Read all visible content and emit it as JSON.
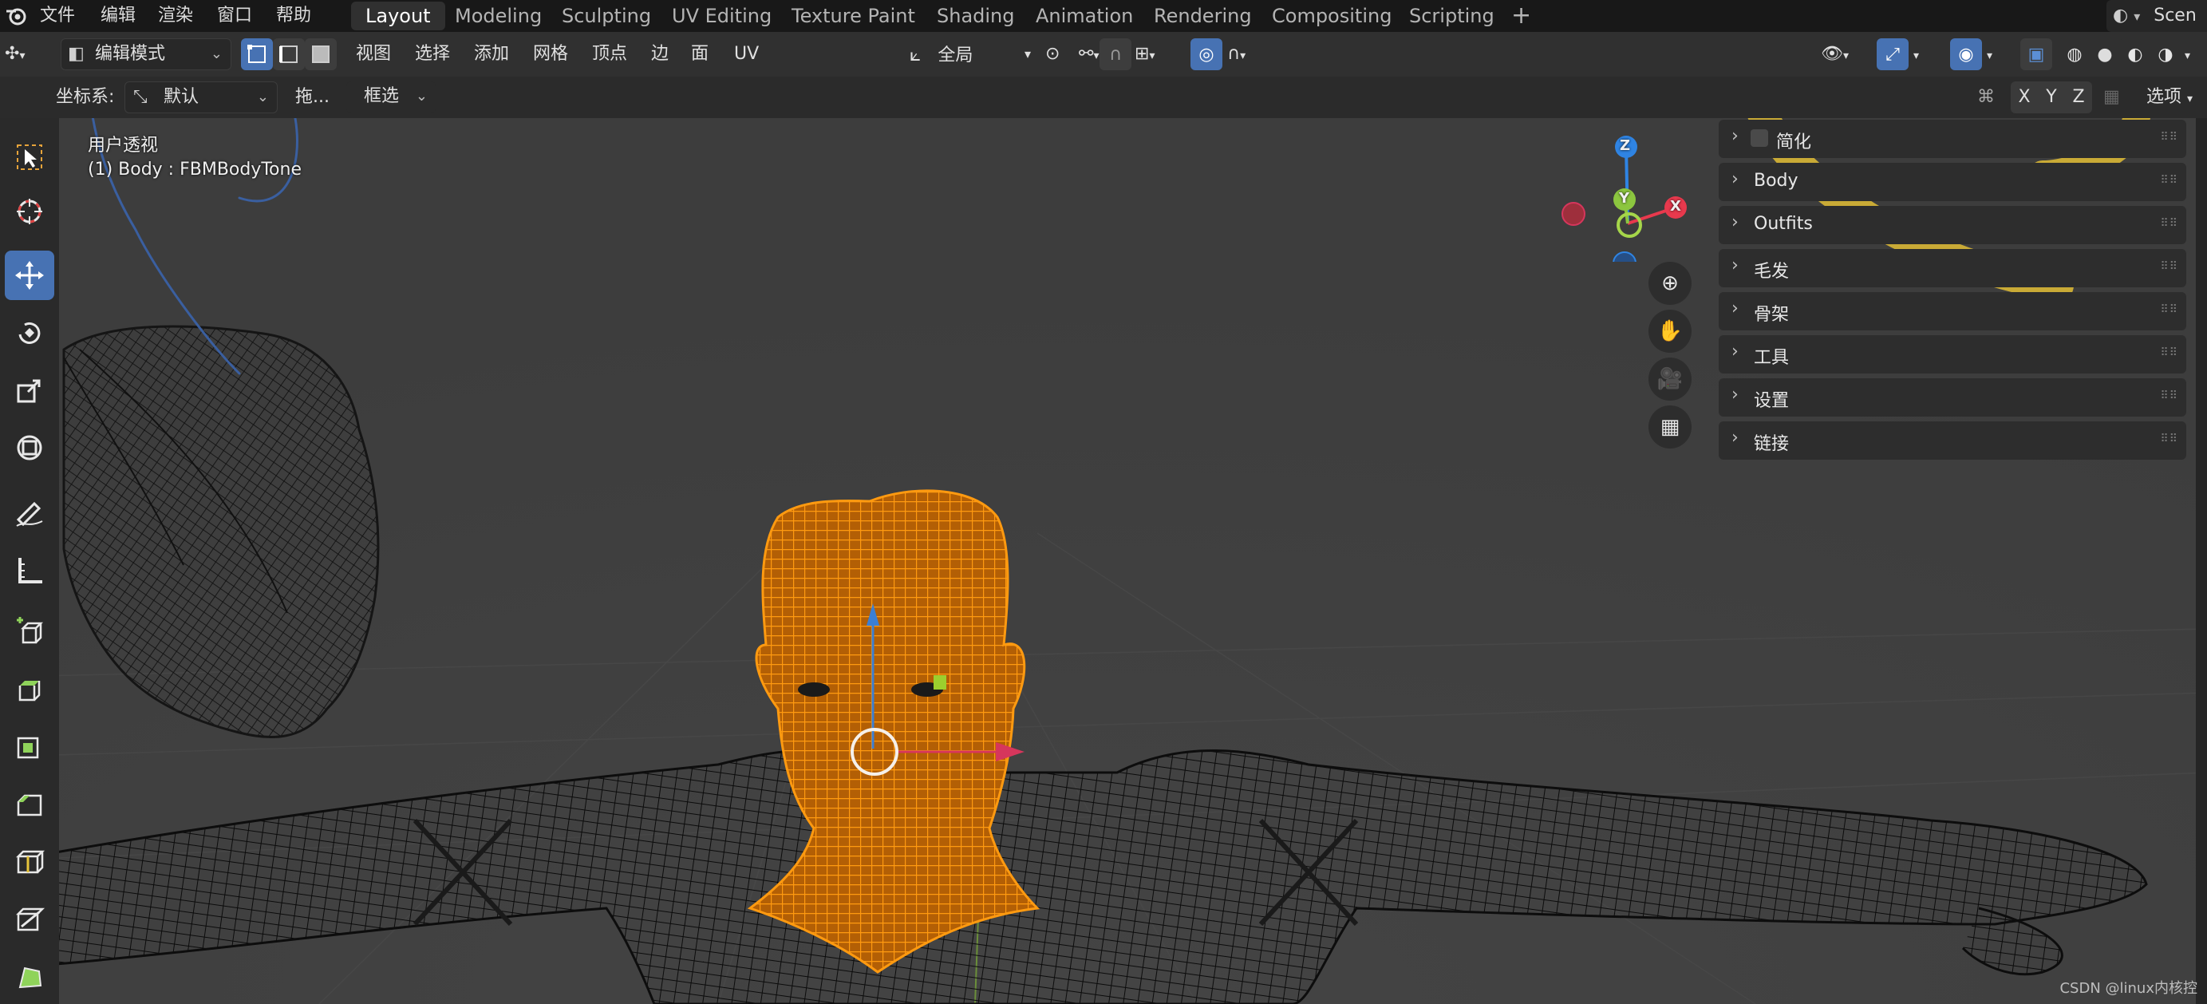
{
  "menu": {
    "items": [
      "文件",
      "编辑",
      "渲染",
      "窗口",
      "帮助"
    ]
  },
  "workspaces": {
    "tabs": [
      "Layout",
      "Modeling",
      "Sculpting",
      "UV Editing",
      "Texture Paint",
      "Shading",
      "Animation",
      "Rendering",
      "Compositing",
      "Scripting"
    ],
    "active": "Layout",
    "add_label": "+"
  },
  "scene_label": "Scen",
  "header": {
    "mode": "编辑模式",
    "menus": [
      "视图",
      "选择",
      "添加",
      "网格",
      "顶点",
      "边",
      "面",
      "UV"
    ],
    "orientation": "全局",
    "options_label": "选项",
    "axes": [
      "X",
      "Y",
      "Z"
    ]
  },
  "tool_settings": {
    "coord_label": "坐标系:",
    "coord_value": "默认",
    "drag_label": "拖...",
    "select_mode": "框选"
  },
  "viewport": {
    "view_name": "用户透视",
    "object_info": "(1) Body : FBMBodyTone"
  },
  "gizmo": {
    "x": "X",
    "y": "Y",
    "z": "Z",
    "colors": {
      "x": "#e8394d",
      "y": "#8cc63f",
      "z": "#2f84e3"
    }
  },
  "npanel": {
    "sections": [
      "简化",
      "Body",
      "Outfits",
      "毛发",
      "骨架",
      "工具",
      "设置",
      "链接"
    ]
  },
  "watermark": "CSDN @linux内核控",
  "colors": {
    "accent": "#4772b3",
    "selected_mesh": "#ff8c00",
    "annotation": "#e8c030"
  }
}
